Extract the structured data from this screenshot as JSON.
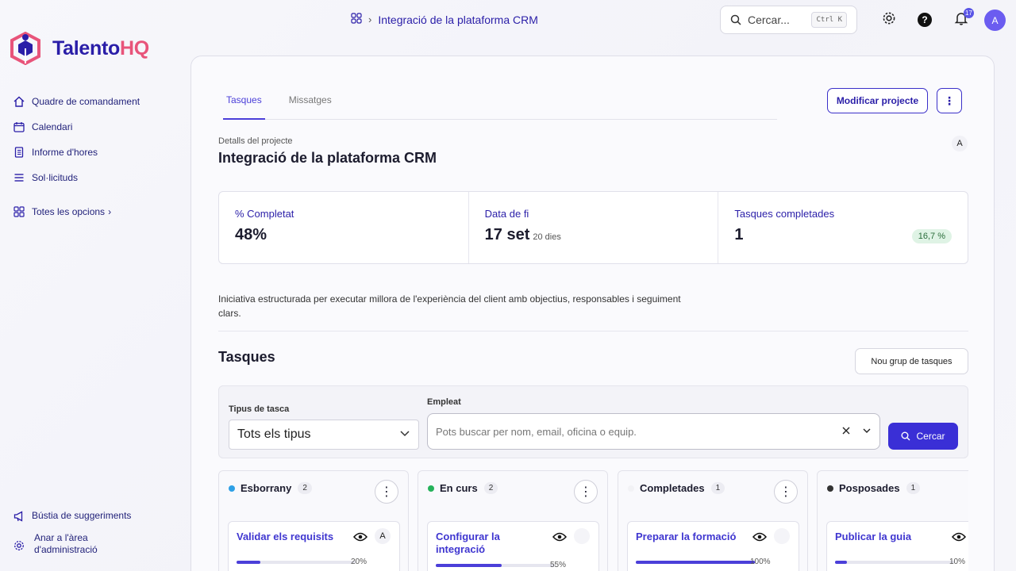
{
  "brand": {
    "name_main": "Talento",
    "name_accent": "HQ",
    "color_main": "#2a1ea8",
    "color_accent": "#e8547a"
  },
  "sidebar": {
    "items": [
      {
        "label": "Quadre de comandament",
        "icon": "home-icon"
      },
      {
        "label": "Calendari",
        "icon": "calendar-icon"
      },
      {
        "label": "Informe d'hores",
        "icon": "report-icon"
      },
      {
        "label": "Sol·licituds",
        "icon": "list-icon"
      }
    ],
    "all_options": "Totes les opcions",
    "bottom": [
      {
        "label": "Bústia de suggeriments",
        "icon": "megaphone-icon"
      },
      {
        "label": "Anar a l'àrea d'administració",
        "icon": "gear-icon"
      }
    ]
  },
  "header": {
    "breadcrumb": "Integració de la plataforma CRM",
    "search_placeholder": "Cercar...",
    "search_shortcut": "Ctrl K",
    "notifications_count": "17",
    "avatar_initial": "A"
  },
  "project": {
    "tabs": [
      {
        "label": "Tasques",
        "active": true
      },
      {
        "label": "Missatges",
        "active": false
      }
    ],
    "edit_button": "Modificar projecte",
    "details_label": "Detalls del projecte",
    "title": "Integració de la plataforma CRM",
    "owner_initial": "A",
    "stats": {
      "completed_label": "% Completat",
      "completed_value": "48%",
      "end_label": "Data de fi",
      "end_value": "17 set",
      "end_note": "20 dies",
      "tasks_label": "Tasques completades",
      "tasks_value": "1",
      "tasks_pill": "16,7 %"
    },
    "description": "Iniciativa estructurada per executar millora de l'experiència del client amb objectius, responsables i seguiment clars."
  },
  "tasks": {
    "title": "Tasques",
    "new_group_button": "Nou grup de tasques",
    "filters": {
      "type_label": "Tipus de tasca",
      "type_value": "Tots els tipus",
      "employee_label": "Empleat",
      "employee_placeholder": "Pots buscar per nom, email, oficina o equip.",
      "search_button": "Cercar"
    },
    "columns": [
      {
        "name": "Esborrany",
        "count": "2",
        "color": "#2ea0e6",
        "card": {
          "title": "Validar els requisits",
          "progress": 20,
          "progress_label": "20%",
          "assignee": "A"
        }
      },
      {
        "name": "En curs",
        "count": "2",
        "color": "#25b25a",
        "card": {
          "title": "Configurar la integració",
          "progress": 55,
          "progress_label": "55%",
          "assignee": ""
        }
      },
      {
        "name": "Completades",
        "count": "1",
        "color": "#f2f2f5",
        "card": {
          "title": "Preparar la formació",
          "progress": 100,
          "progress_label": "100%",
          "assignee": ""
        }
      },
      {
        "name": "Posposades",
        "count": "1",
        "color": "#333333",
        "card": {
          "title": "Publicar la guia",
          "progress": 10,
          "progress_label": "10%",
          "assignee": ""
        }
      }
    ]
  }
}
